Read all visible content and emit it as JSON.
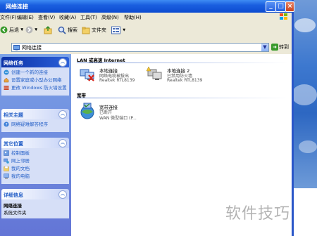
{
  "window": {
    "title": "网络连接"
  },
  "menu": [
    "文件(F)",
    "编辑(E)",
    "查看(V)",
    "收藏(A)",
    "工具(T)",
    "高级(N)",
    "帮助(H)"
  ],
  "toolbar": {
    "back_label": "后退",
    "search_label": "搜索",
    "folders_label": "文件夹"
  },
  "address": {
    "label": "地址(D)",
    "value": "网络连接",
    "go_label": "转到"
  },
  "taskpane": {
    "network_tasks": {
      "title": "网络任务",
      "items": [
        "创建一个新的连接",
        "设置家庭或小型办公网络",
        "更改 Windows 防火墙设置"
      ]
    },
    "see_also": {
      "title": "相关主题",
      "items": [
        "网络疑难解答程序"
      ]
    },
    "other_places": {
      "title": "其它位置",
      "items": [
        "控制面板",
        "网上邻居",
        "我的文档",
        "我的电脑"
      ]
    },
    "details": {
      "title": "详细信息",
      "name": "网络连接",
      "sub": "系统文件夹"
    }
  },
  "groups": {
    "lan": {
      "title": "LAN 或高速 Internet",
      "connections": [
        {
          "name": "本地连接",
          "status": "网络电缆被拔出",
          "device": "Realtek RTL8139"
        },
        {
          "name": "本地连接 2",
          "status": "已禁用防火墙",
          "device": "Realtek RTL8139"
        }
      ]
    },
    "broadband": {
      "title": "宽带",
      "connections": [
        {
          "name": "宽带连接",
          "status": "已断开",
          "device": "WAN 微型端口 (P..."
        }
      ]
    }
  },
  "watermark": "软件技巧"
}
